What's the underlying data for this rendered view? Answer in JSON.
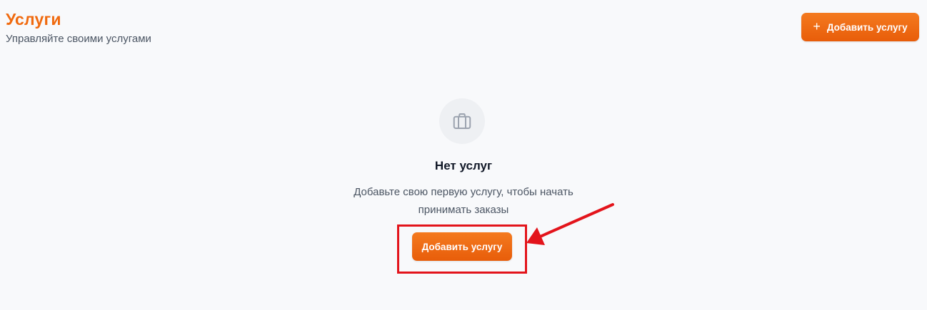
{
  "header": {
    "title": "Услуги",
    "subtitle": "Управляйте своими услугами",
    "add_button": {
      "icon": "plus-icon",
      "label": "Добавить услугу"
    }
  },
  "empty_state": {
    "icon": "briefcase-icon",
    "title": "Нет услуг",
    "description": "Добавьте свою первую услугу, чтобы начать принимать заказы",
    "add_button_label": "Добавить услугу"
  },
  "colors": {
    "accent": "#f06a0f",
    "button": "#ed6a14",
    "annotation": "#e3141b",
    "background": "#f8f9fb"
  }
}
